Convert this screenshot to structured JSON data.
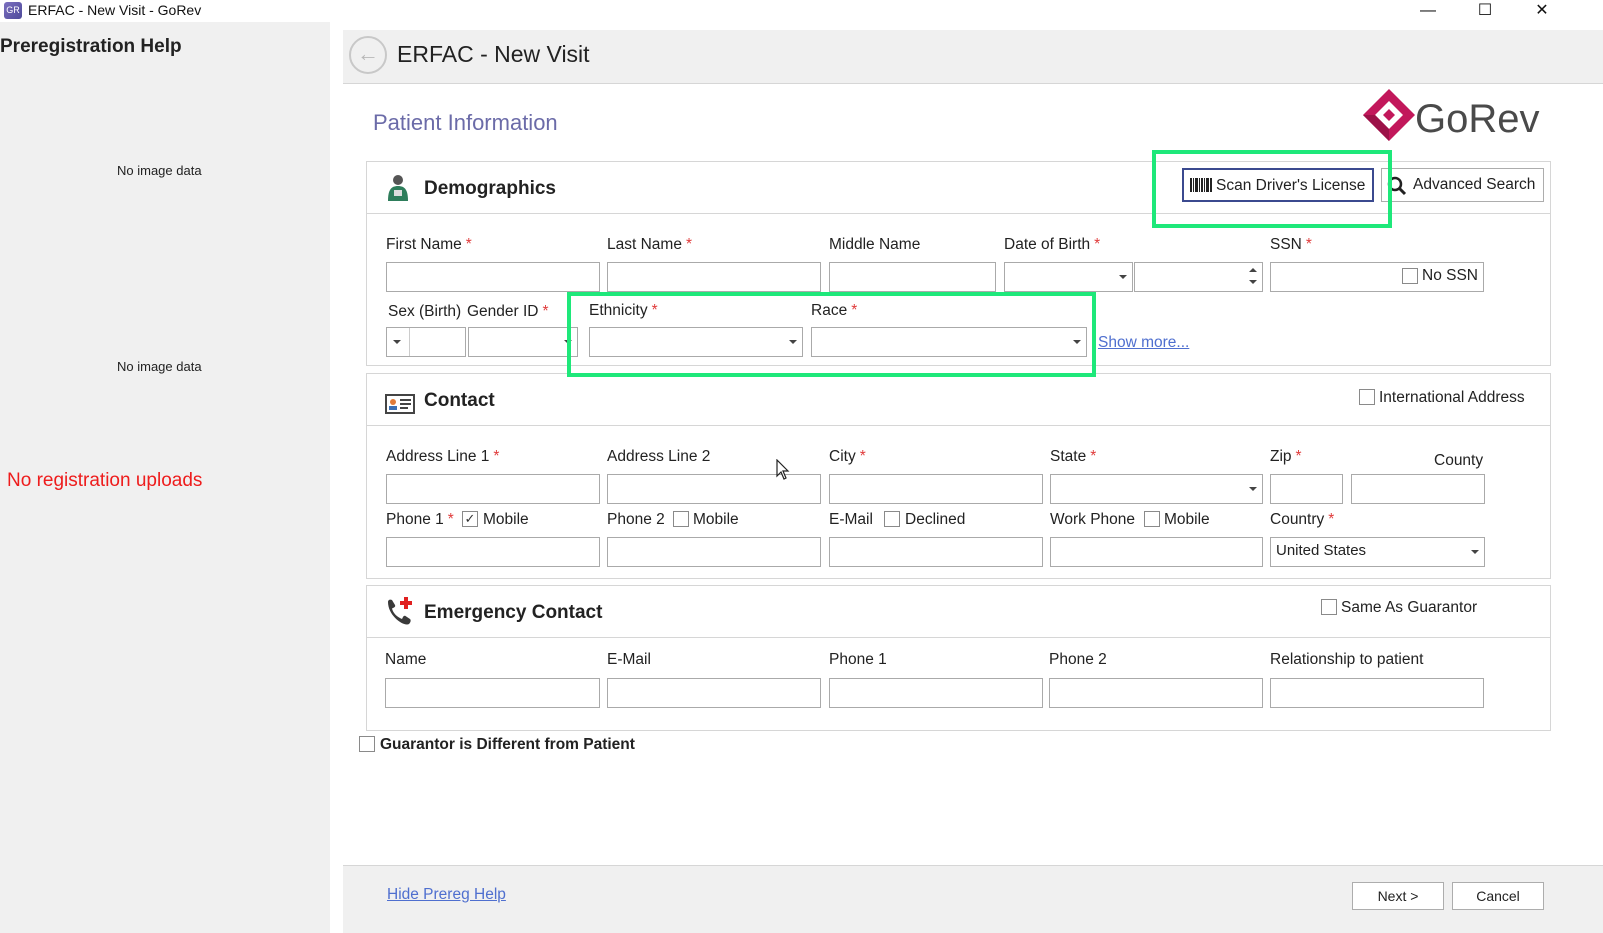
{
  "window": {
    "title": "ERFAC - New Visit - GoRev",
    "app_icon_text": "GR",
    "minimize": "—",
    "maximize": "☐",
    "close": "✕"
  },
  "help_pane": {
    "title": "Preregistration Help",
    "image_placeholder_1": "No image data",
    "image_placeholder_2": "No image data",
    "uploads_status": "No registration uploads"
  },
  "header": {
    "back_icon": "←",
    "title": "ERFAC - New Visit"
  },
  "section_title": "Patient Information",
  "logo_text": "GoRev",
  "demographics": {
    "title": "Demographics",
    "scan_button": "Scan Driver's License",
    "advanced_search_button": "Advanced Search",
    "first_name": "First Name",
    "last_name": "Last Name",
    "middle_name": "Middle Name",
    "dob": "Date of Birth",
    "ssn": "SSN",
    "no_ssn": "No SSN",
    "sex_birth": "Sex (Birth)",
    "gender_id": "Gender ID",
    "ethnicity": "Ethnicity",
    "race": "Race",
    "show_more": "Show more..."
  },
  "contact": {
    "title": "Contact",
    "international_address": "International Address",
    "address1": "Address Line 1",
    "address2": "Address Line 2",
    "city": "City",
    "state": "State",
    "zip": "Zip",
    "county": "County",
    "phone1": "Phone 1",
    "phone2": "Phone 2",
    "email": "E-Mail",
    "work_phone": "Work Phone",
    "country": "Country",
    "mobile": "Mobile",
    "declined": "Declined",
    "country_value": "United States"
  },
  "emergency": {
    "title": "Emergency Contact",
    "same_as_guarantor": "Same As Guarantor",
    "name": "Name",
    "email": "E-Mail",
    "phone1": "Phone 1",
    "phone2": "Phone 2",
    "relationship": "Relationship to patient"
  },
  "guarantor_different": "Guarantor is Different from Patient",
  "footer": {
    "hide_help": "Hide Prereg Help",
    "next": "Next >",
    "cancel": "Cancel"
  },
  "required_marker": "*",
  "checkmark": "✓",
  "colors": {
    "highlight": "#1ee87a",
    "section_title": "#6b6ba8",
    "required": "#e03a3a",
    "error_text": "#ee1c1c",
    "link": "#4f6fcf",
    "logo_magenta": "#c2185b"
  }
}
